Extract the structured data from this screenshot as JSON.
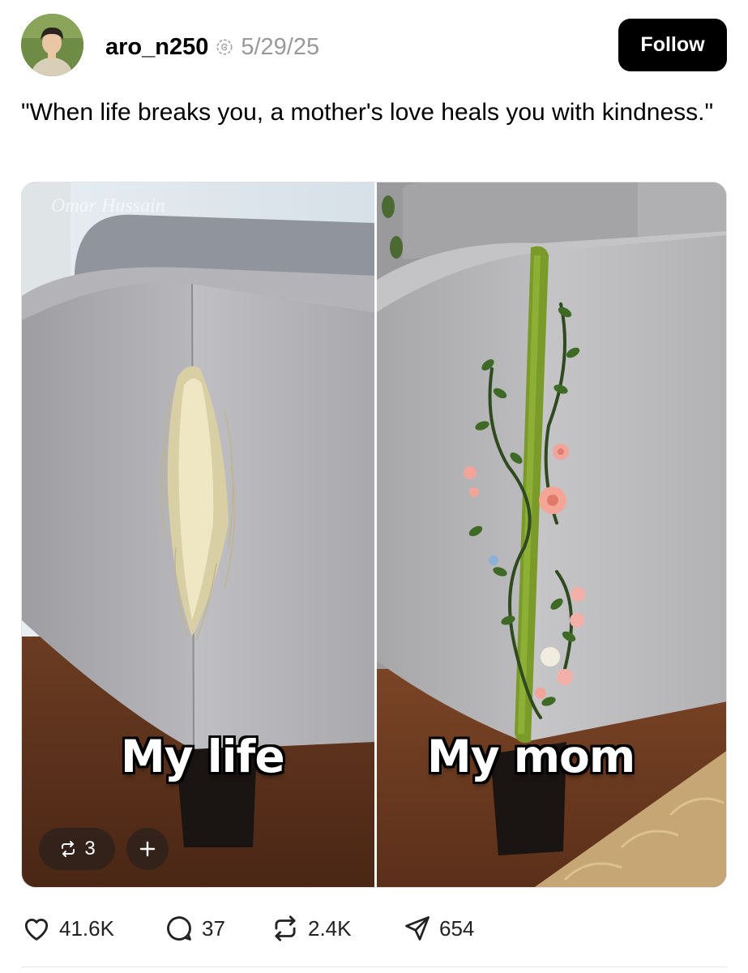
{
  "post": {
    "username": "aro_n250",
    "date": "5/29/25",
    "follow_label": "Follow",
    "caption": "\"When life breaks you, a mother's love heals you with kindness.\""
  },
  "media": {
    "watermark": "Omar Hussain",
    "left_caption": "My life",
    "right_caption": "My mom",
    "repost_count": "3",
    "add_label": "+"
  },
  "actions": {
    "likes": "41.6K",
    "replies": "37",
    "reposts": "2.4K",
    "shares": "654"
  },
  "icons": {
    "verified": "threads-verified-icon",
    "like": "heart-icon",
    "reply": "comment-bubble-icon",
    "repost": "repost-arrows-icon",
    "share": "paper-plane-icon",
    "add": "plus-icon"
  },
  "colors": {
    "follow_bg": "#000000",
    "follow_text": "#ffffff",
    "meta_gray": "#999999",
    "chip_bg": "rgba(40,32,28,0.72)"
  }
}
